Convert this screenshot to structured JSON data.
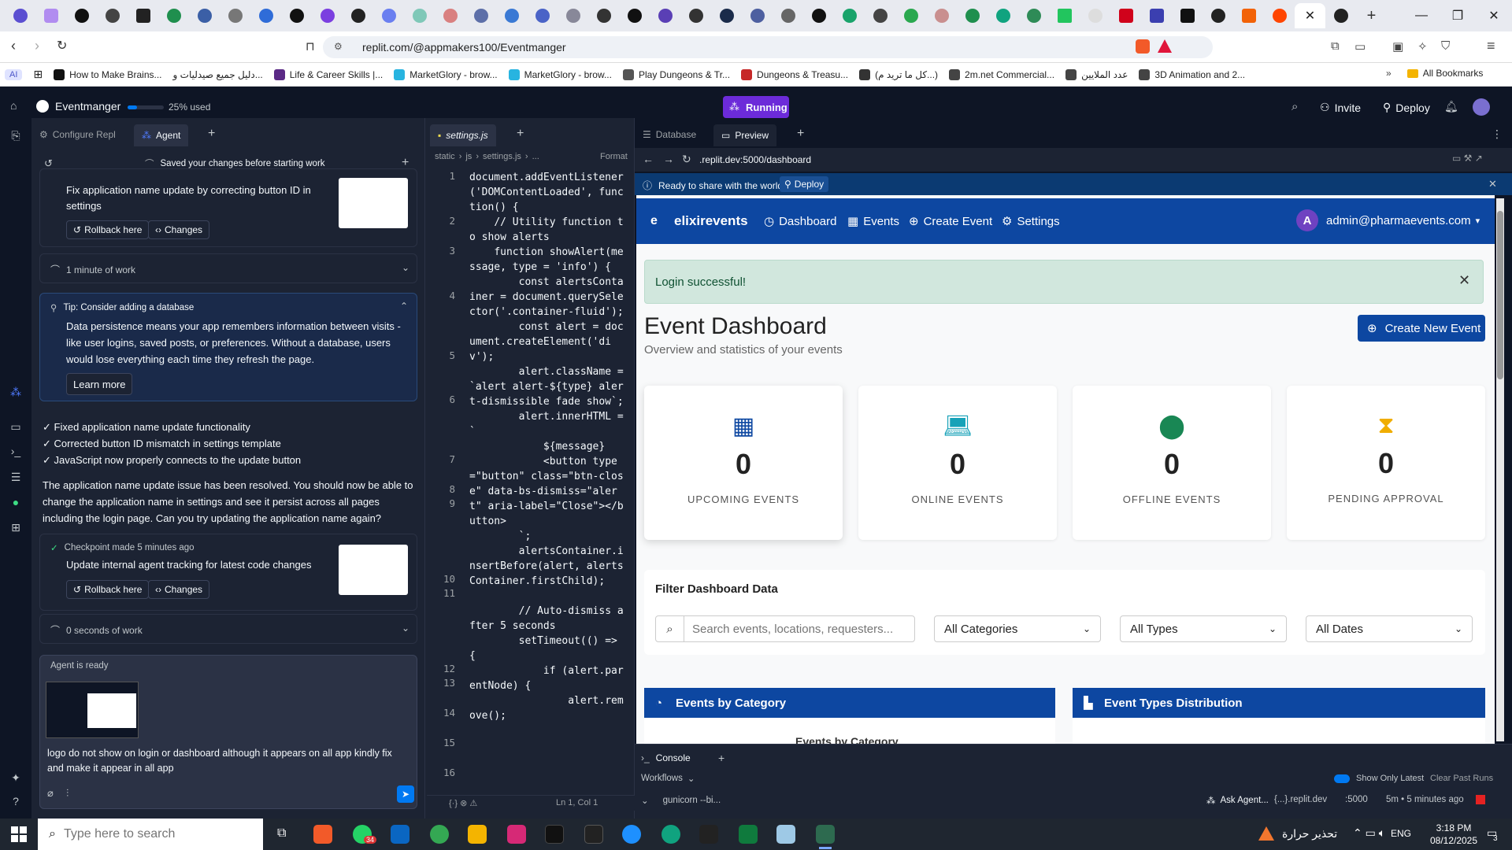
{
  "browser": {
    "url": "replit.com/@appmakers100/Eventmanger",
    "bookmarks": [
      "How to Make Brains...",
      "دليل جميع صيدليات و...",
      "Life & Career Skills |...",
      "MarketGlory - brow...",
      "MarketGlory - brow...",
      "Play Dungeons & Tr...",
      "Dungeons & Treasu...",
      "(كل ما تريد م...)",
      "2m.net Commercial...",
      "عدد الملايين",
      "3D Animation and 2..."
    ],
    "all_bookmarks": "All Bookmarks",
    "profile_label": "AI"
  },
  "replit": {
    "project_name": "Eventmanger",
    "usage": "25% used",
    "usage_fraction": 0.25,
    "running_label": "Running",
    "invite_label": "Invite",
    "deploy_label": "Deploy"
  },
  "agent_panel": {
    "tabs": [
      "Configure Repl",
      "Agent"
    ],
    "saved_notice": "Saved your changes before starting work",
    "checkpoint1_title": "Fix application name update by correcting button ID in settings",
    "rollback_label": "Rollback here",
    "changes_label": "Changes",
    "work_time_1": "1 minute of work",
    "tip_title": "Tip: Consider adding a database",
    "tip_body": "Data persistence means your app remembers information between visits - like user logins, saved posts, or preferences. Without a database, users would lose everything each time they refresh the page.",
    "learn_more": "Learn more",
    "checklist": [
      "✓ Fixed application name update functionality",
      "✓ Corrected button ID mismatch in settings template",
      "✓ JavaScript now properly connects to the update button"
    ],
    "summary": "The application name update issue has been resolved. You should now be able to change the application name in settings and see it persist across all pages including the login page. Can you try updating the application name again?",
    "checkpoint2_meta": "Checkpoint made 5 minutes ago",
    "checkpoint2_title": "Update internal agent tracking for latest code changes",
    "work_time_2": "0 seconds of work",
    "agent_status": "Agent is ready",
    "input_text": "logo do not show on login or dashboard although it appears on all app kindly fix and make it appear in all app"
  },
  "editor": {
    "tab": "settings.js",
    "breadcrumb": [
      "static",
      "js",
      "settings.js",
      "..."
    ],
    "format_label": "Format",
    "line_numbers": [
      "1",
      "2",
      "3",
      "4",
      "5",
      "6",
      "7",
      "8",
      "9",
      "10",
      "11",
      "12",
      "13",
      "14",
      "15",
      "16"
    ],
    "code": "document.addEventListener('DOMContentLoaded', function() {\n    // Utility function to show alerts\n    function showAlert(message, type = 'info') {\n        const alertsContainer = document.querySelector('.container-fluid');\n        const alert = document.createElement('div');\n        alert.className = `alert alert-${type} alert-dismissible fade show`;\n        alert.innerHTML = `\n            ${message}\n            <button type=\"button\" class=\"btn-close\" data-bs-dismiss=\"alert\" aria-label=\"Close\"></button>\n        `;\n        alertsContainer.insertBefore(alert, alertsContainer.firstChild);\n\n        // Auto-dismiss after 5 seconds\n        setTimeout(() => {\n            if (alert.parentNode) {\n                alert.remove();",
    "status": "Ln 1, Col 1"
  },
  "preview": {
    "tabs": [
      "Database",
      "Preview"
    ],
    "url": ".replit.dev:5000/dashboard",
    "share_text": "Ready to share with the world?",
    "share_deploy": "Deploy",
    "app": {
      "brand": "elixirevents",
      "brand_letter": "e",
      "nav": [
        "Dashboard",
        "Events",
        "Create Event",
        "Settings"
      ],
      "user_initial": "A",
      "user_email": "admin@pharmaevents.com",
      "alert": "Login successful!",
      "title": "Event Dashboard",
      "subtitle": "Overview and statistics of your events",
      "create_button": "Create New Event",
      "stats": [
        {
          "value": "0",
          "label": "UPCOMING EVENTS",
          "color": "#0d47a1"
        },
        {
          "value": "0",
          "label": "ONLINE EVENTS",
          "color": "#17a2b8"
        },
        {
          "value": "0",
          "label": "OFFLINE EVENTS",
          "color": "#198754"
        },
        {
          "value": "0",
          "label": "PENDING APPROVAL",
          "color": "#f0ad00"
        }
      ],
      "filter_title": "Filter Dashboard Data",
      "search_placeholder": "Search events, locations, requesters...",
      "filters": [
        "All Categories",
        "All Types",
        "All Dates"
      ],
      "section1": "Events by Category",
      "section1_sub": "Events by Category",
      "section2": "Event Types Distribution"
    }
  },
  "console": {
    "tab": "Console",
    "workflows": "Workflows",
    "process": "gunicorn --bi...",
    "show_only_latest": "Show Only Latest",
    "clear_past": "Clear Past Runs",
    "ask_agent": "Ask Agent...",
    "domain": "{...}.replit.dev",
    "port": ":5000",
    "timing": "5m • 5 minutes ago"
  },
  "taskbar": {
    "search_placeholder": "Type here to search",
    "weather_text": "تحذير حرارة",
    "lang": "ENG",
    "time": "3:18 PM",
    "date": "08/12/2025",
    "notif_count": "3",
    "whatsapp_badge": "34"
  }
}
